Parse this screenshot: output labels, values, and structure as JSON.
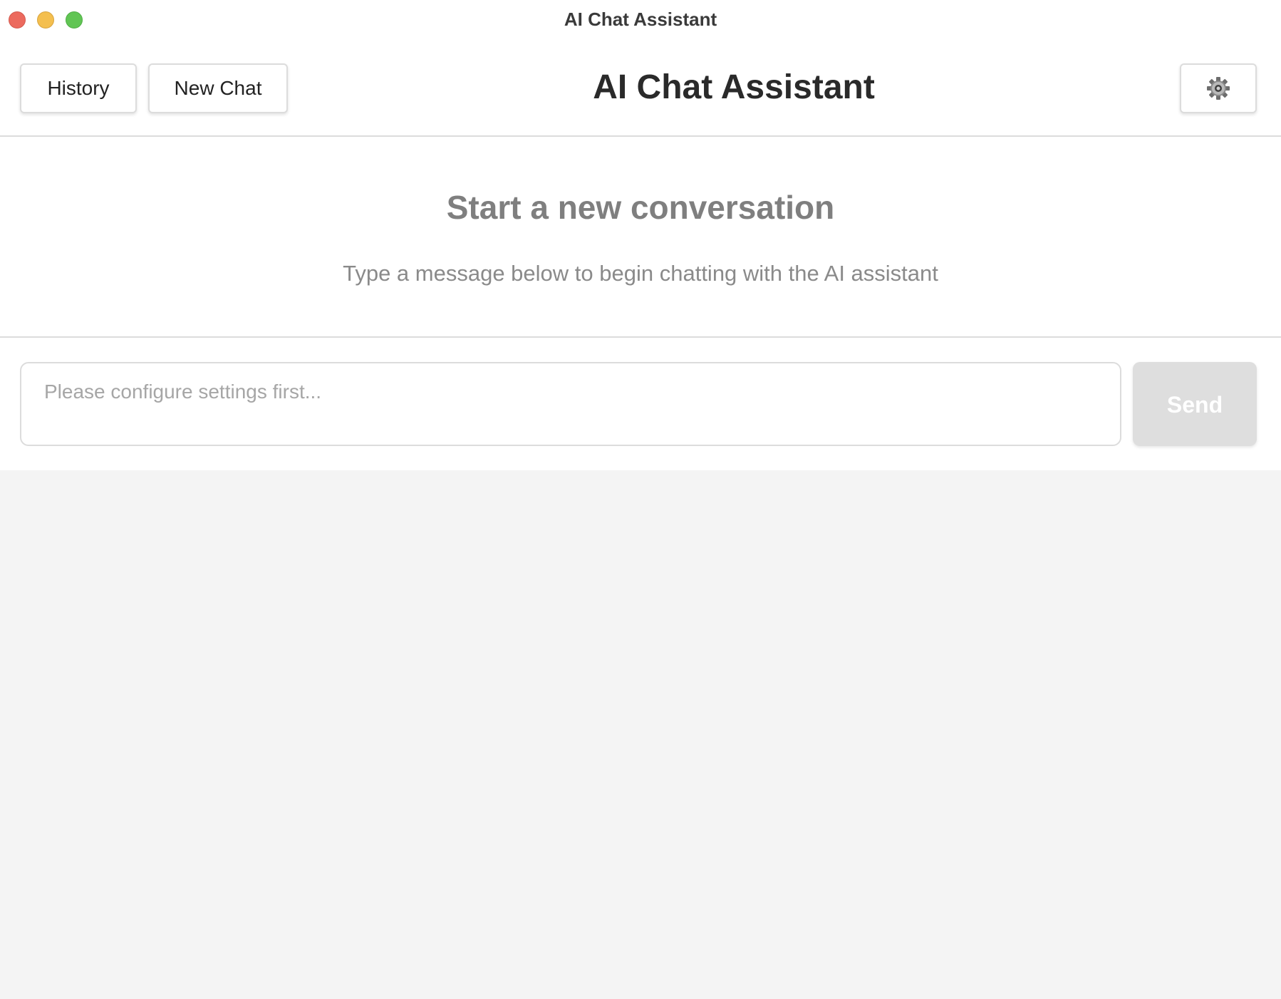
{
  "window": {
    "title": "AI Chat Assistant",
    "controls": [
      "close",
      "minimize",
      "zoom"
    ]
  },
  "header": {
    "history_label": "History",
    "new_chat_label": "New Chat",
    "title": "AI Chat Assistant",
    "settings_icon": "gear-icon"
  },
  "empty_state": {
    "heading": "Start a new conversation",
    "subtext": "Type a message below to begin chatting with the AI assistant"
  },
  "composer": {
    "placeholder": "Please configure settings first...",
    "value": "",
    "send_label": "Send",
    "send_enabled": false
  },
  "colors": {
    "close": "#ec6a5e",
    "minimize": "#f4bf4f",
    "zoom": "#61c554",
    "send_disabled": "#dedede"
  }
}
